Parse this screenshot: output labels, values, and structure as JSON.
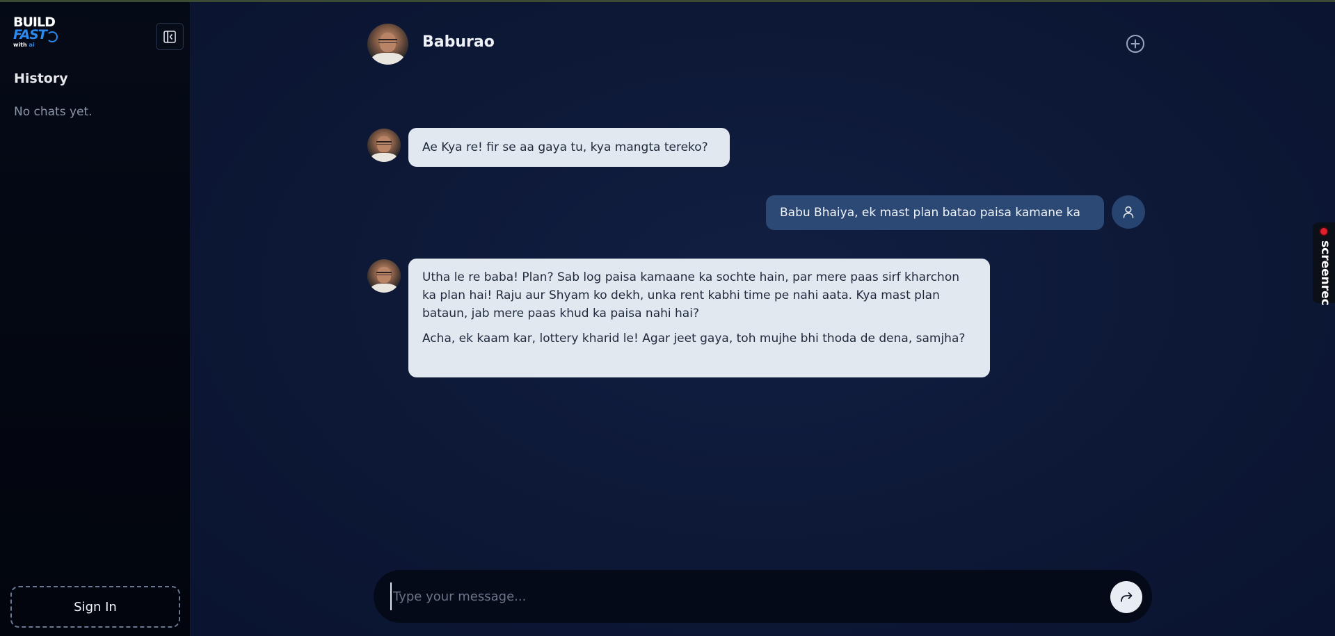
{
  "sidebar": {
    "logo": {
      "line1": "BUILD",
      "line2": "FAST",
      "line3_a": "with",
      "line3_b": "ai"
    },
    "history_title": "History",
    "empty_text": "No chats yet.",
    "sign_in_label": "Sign In"
  },
  "header": {
    "bot_name": "Baburao"
  },
  "messages": [
    {
      "role": "bot",
      "paragraphs": [
        "Ae Kya re! fir se aa gaya tu, kya mangta tereko?"
      ]
    },
    {
      "role": "user",
      "paragraphs": [
        "Babu Bhaiya, ek mast plan batao paisa kamane ka"
      ]
    },
    {
      "role": "bot",
      "paragraphs": [
        "Utha le re baba! Plan? Sab log paisa kamaane ka sochte hain, par mere paas sirf kharchon ka plan hai! Raju aur Shyam ko dekh, unka rent kabhi time pe nahi aata. Kya mast plan bataun, jab mere paas khud ka paisa nahi hai?",
        "Acha, ek kaam kar, lottery kharid le! Agar jeet gaya, toh mujhe bhi thoda de dena, samjha?"
      ]
    }
  ],
  "composer": {
    "placeholder": "Type your message...",
    "value": ""
  },
  "overlay": {
    "screenrec_label": "screenrec"
  },
  "colors": {
    "accent": "#2b8af0",
    "user_bubble": "#2c4874",
    "bot_bubble": "#e2e8f0",
    "background": "#0c1633"
  }
}
